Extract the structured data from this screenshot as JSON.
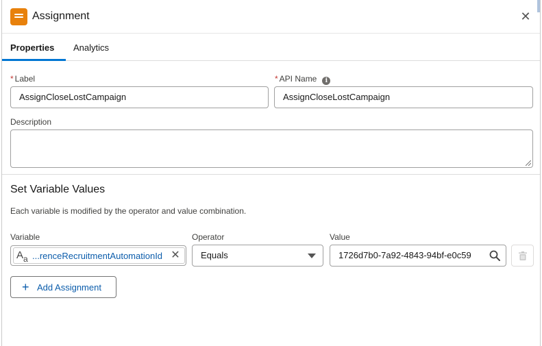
{
  "header": {
    "title": "Assignment",
    "close_glyph": "✕",
    "accent_color": "#e8810c"
  },
  "tabs": [
    {
      "label": "Properties",
      "active": true
    },
    {
      "label": "Analytics",
      "active": false
    }
  ],
  "form": {
    "label_field": {
      "label": "Label",
      "required": true,
      "value": "AssignCloseLostCampaign"
    },
    "api_name_field": {
      "label": "API Name",
      "required": true,
      "value": "AssignCloseLostCampaign",
      "info_glyph": "i"
    },
    "description_field": {
      "label": "Description",
      "value": ""
    }
  },
  "set_variables": {
    "title": "Set Variable Values",
    "description": "Each variable is modified by the operator and value combination.",
    "columns": {
      "variable": "Variable",
      "operator": "Operator",
      "value": "Value"
    },
    "row": {
      "variable_type_icon": "text-type-icon",
      "variable_type_glyph_big": "A",
      "variable_type_glyph_small": "a",
      "variable_value": "...renceRecruitmentAutomationId",
      "remove_glyph": "✕",
      "operator_value": "Equals",
      "value_value": "1726d7b0-7a92-4843-94bf-e0c59"
    },
    "add_button_label": "Add Assignment",
    "add_button_glyph": "+"
  },
  "colors": {
    "link_blue": "#0b5cab",
    "tab_active_underline": "#0176d3",
    "required_red": "#c23934"
  }
}
